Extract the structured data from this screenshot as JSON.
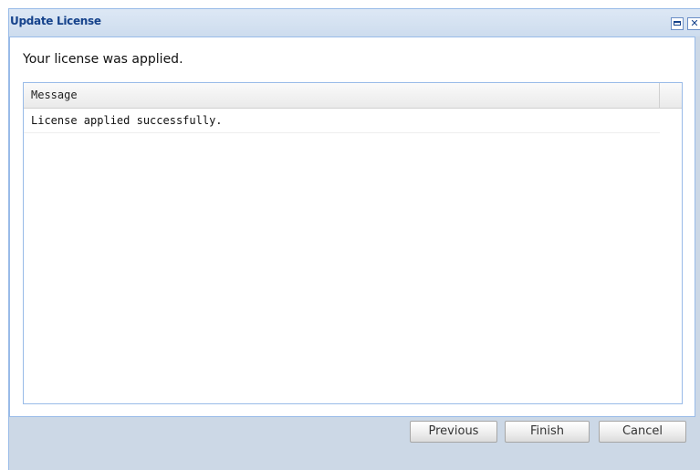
{
  "window": {
    "title": "Update License",
    "maximize_icon": "maximize-icon",
    "close_icon": "close-icon",
    "close_glyph": "✕"
  },
  "content": {
    "status_text": "Your license was applied."
  },
  "grid": {
    "columns": [
      "Message"
    ],
    "rows": [
      {
        "message": "License applied successfully."
      }
    ]
  },
  "buttons": {
    "previous": "Previous",
    "finish": "Finish",
    "cancel": "Cancel"
  },
  "colors": {
    "title_text": "#15428b",
    "frame": "#ccd8e6",
    "border": "#99bbe8"
  }
}
